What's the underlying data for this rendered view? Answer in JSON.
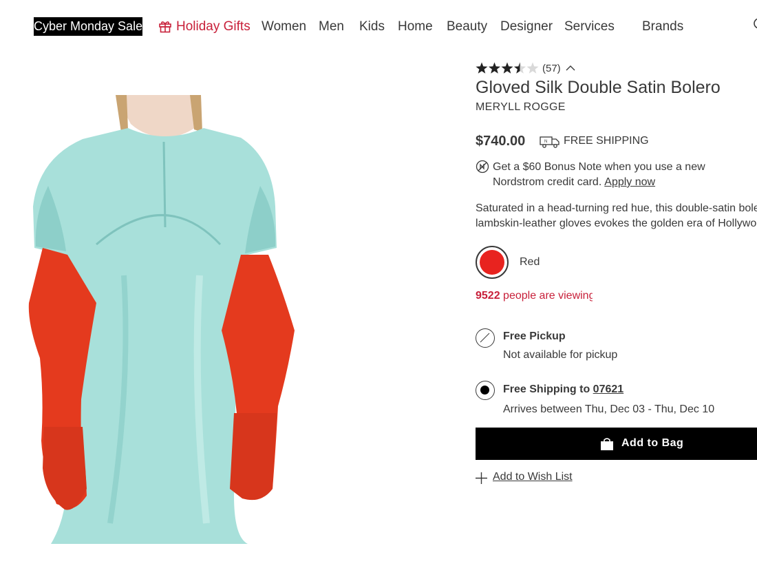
{
  "nav": {
    "items": [
      "Cyber Monday Sale",
      "Holiday Gifts",
      "Women",
      "Men",
      "Kids",
      "Home",
      "Beauty",
      "Designer",
      "Services",
      "Brands"
    ],
    "gift_icon": "gift-icon",
    "search_icon": "search-icon"
  },
  "product": {
    "rating": 3.5,
    "rating_max": 5,
    "review_count": "(57)",
    "title": "Gloved Silk Double Satin Bolero",
    "brand": "MERYLL ROGGE",
    "price": "$740.00",
    "shipping_label": "FREE SHIPPING",
    "bonus_text": "Get a $60 Bonus Note when you use a new Nordstrom credit card.",
    "bonus_link": "Apply now",
    "description_line1": "Saturated in a head-turning red hue, this double-satin bolero f",
    "description_line2": "lambskin-leather gloves evokes the golden era of Hollywood.",
    "color": {
      "name": "Red",
      "swatch": "#e8231f"
    },
    "viewers_count": "9522",
    "viewers_text": "people are viewing"
  },
  "fulfillment": {
    "pickup": {
      "title": "Free Pickup",
      "subtitle": "Not available for pickup",
      "selected": false
    },
    "shipping": {
      "title_prefix": "Free Shipping to",
      "zip": "07621",
      "subtitle": "Arrives between Thu, Dec 03 - Thu, Dec 10",
      "selected": true
    }
  },
  "actions": {
    "add_to_bag": "Add to Bag",
    "add_to_wishlist": "Add to Wish List"
  },
  "colors": {
    "text": "#393939",
    "accent_red": "#c8203a",
    "button_bg": "#000000",
    "dress": "#a8e0da",
    "gloves": "#e43a1e"
  }
}
